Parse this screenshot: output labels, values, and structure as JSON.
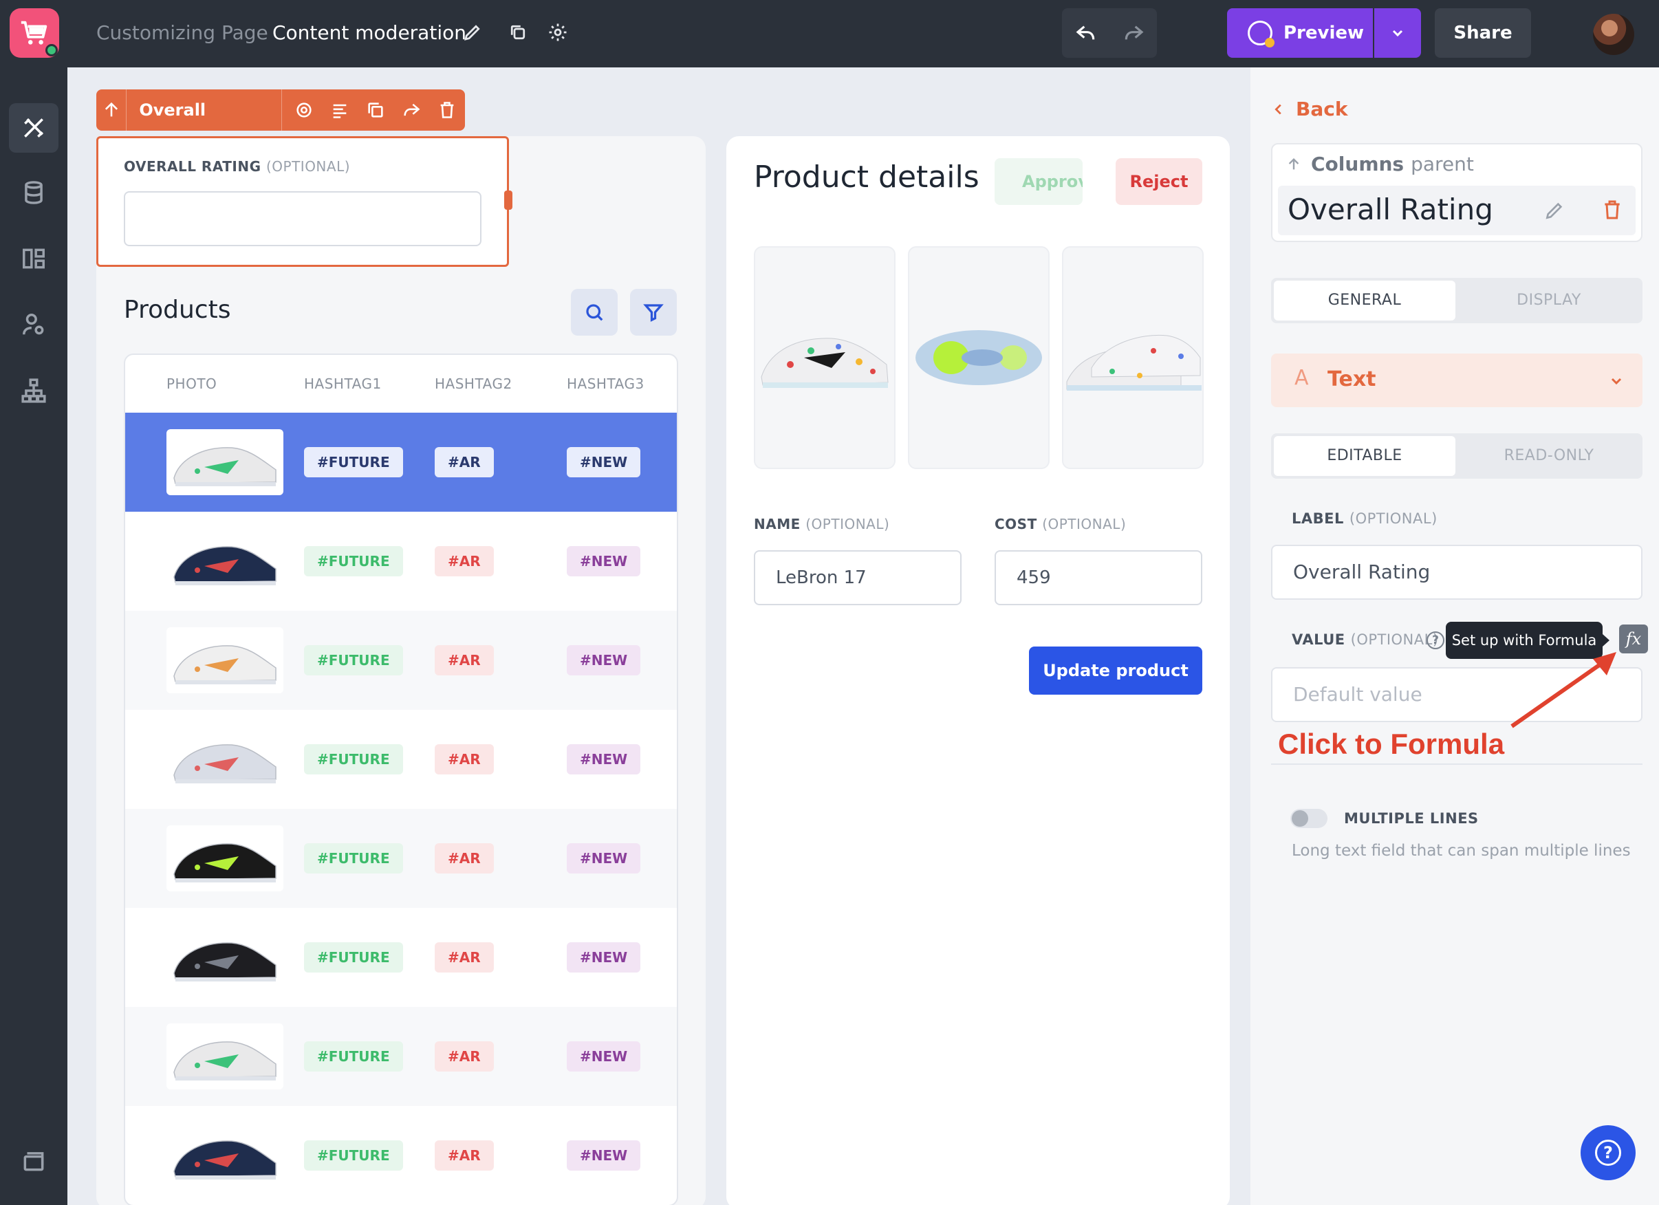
{
  "header": {
    "breadcrumb_parent": "Customizing Page",
    "page_name": "Content moderation",
    "preview_label": "Preview",
    "share_label": "Share"
  },
  "sidebar": {
    "items": [
      "design-icon",
      "database-icon",
      "layout-icon",
      "user-settings-icon",
      "sitemap-icon",
      "pages-icon"
    ]
  },
  "selection_toolbar": {
    "component_name": "Overall Rating"
  },
  "rating_field": {
    "label": "OVERALL RATING",
    "optional": "(OPTIONAL)",
    "value": ""
  },
  "products": {
    "title": "Products",
    "columns": [
      "PHOTO",
      "HASHTAG1",
      "HASHTAG2",
      "HASHTAG3"
    ],
    "rows": [
      {
        "tags": [
          "#FUTURE",
          "#AR",
          "#NEW"
        ],
        "shoe_color": "#e9e9ea",
        "accent": "#3cc27a",
        "selected": true
      },
      {
        "tags": [
          "#FUTURE",
          "#AR",
          "#NEW"
        ],
        "shoe_color": "#1f2d4d",
        "accent": "#d94a4a",
        "selected": false
      },
      {
        "tags": [
          "#FUTURE",
          "#AR",
          "#NEW"
        ],
        "shoe_color": "#efefef",
        "accent": "#e89a4a",
        "selected": false
      },
      {
        "tags": [
          "#FUTURE",
          "#AR",
          "#NEW"
        ],
        "shoe_color": "#d9dde6",
        "accent": "#e06060",
        "selected": false
      },
      {
        "tags": [
          "#FUTURE",
          "#AR",
          "#NEW"
        ],
        "shoe_color": "#1a1a1a",
        "accent": "#b6f03a",
        "selected": false
      },
      {
        "tags": [
          "#FUTURE",
          "#AR",
          "#NEW"
        ],
        "shoe_color": "#1e1e22",
        "accent": "#7a7f8a",
        "selected": false
      },
      {
        "tags": [
          "#FUTURE",
          "#AR",
          "#NEW"
        ],
        "shoe_color": "#e9e9ea",
        "accent": "#3cc27a",
        "selected": false
      },
      {
        "tags": [
          "#FUTURE",
          "#AR",
          "#NEW"
        ],
        "shoe_color": "#1f2d4d",
        "accent": "#d94a4a",
        "selected": false
      }
    ]
  },
  "product_details": {
    "title": "Product details",
    "approve_label": "Approve",
    "reject_label": "Reject",
    "name_label": "NAME",
    "name_optional": "(OPTIONAL)",
    "name_value": "LeBron 17",
    "cost_label": "COST",
    "cost_optional": "(OPTIONAL)",
    "cost_value": "459",
    "update_label": "Update product"
  },
  "panel": {
    "back_label": "Back",
    "columns_label": "Columns",
    "parent_label": "parent",
    "component_name": "Overall Rating",
    "tabs": [
      "GENERAL",
      "DISPLAY"
    ],
    "type_label": "Text",
    "mode_tabs": [
      "EDITABLE",
      "READ-ONLY"
    ],
    "label_label": "LABEL",
    "label_optional": "(OPTIONAL)",
    "label_value": "Overall Rating",
    "value_label": "VALUE",
    "value_optional": "(OPTIONAL)",
    "value_placeholder": "Default value",
    "tooltip": "Set up with Formula",
    "fx_label": "fx",
    "annotation": "Click to Formula",
    "multiline_label": "MULTIPLE LINES",
    "multiline_desc": "Long text field that can span multiple lines"
  },
  "colors": {
    "accent_orange": "#e3683f",
    "primary_blue": "#2b55e6",
    "preview_purple": "#7b3fe4",
    "selected_row": "#5b7ce6"
  }
}
